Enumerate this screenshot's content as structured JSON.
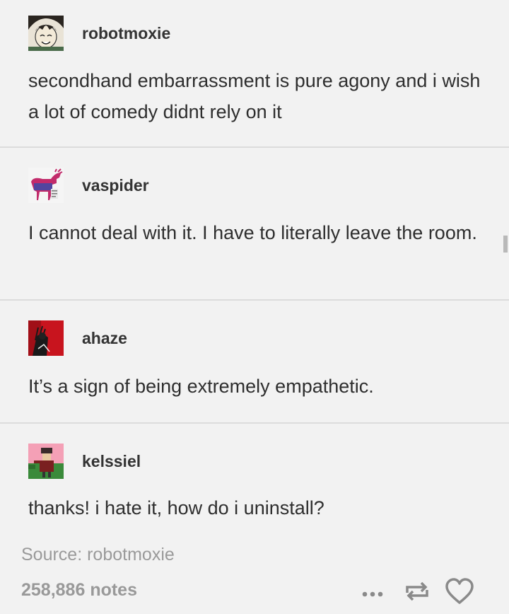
{
  "posts": [
    {
      "username": "robotmoxie",
      "avatar_icon": "anime-face-avatar-icon",
      "text": "secondhand embarrassment is pure agony and i wish a lot of comedy didnt rely on it"
    },
    {
      "username": "vaspider",
      "avatar_icon": "moose-avatar-icon",
      "text": "I cannot deal with it. I have to literally leave the room."
    },
    {
      "username": "ahaze",
      "avatar_icon": "red-character-avatar-icon",
      "text": "It’s a sign of being extremely empathetic."
    },
    {
      "username": "kelssiel",
      "avatar_icon": "pixel-character-avatar-icon",
      "text": "thanks! i hate it, how do i uninstall?"
    }
  ],
  "footer": {
    "source": "Source: robotmoxie",
    "notes": "258,886 notes",
    "icons": [
      "more-icon",
      "reblog-icon",
      "heart-icon"
    ]
  },
  "colors": {
    "background": "#f2f2f2",
    "divider": "#dcdcdc",
    "meta_text": "#9a9a9a"
  }
}
